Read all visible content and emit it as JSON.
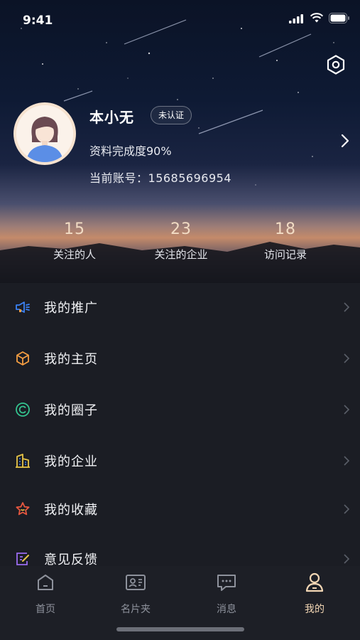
{
  "status_bar": {
    "time": "9:41"
  },
  "profile": {
    "name": "本小无",
    "verify_badge": "未认证",
    "completion": "资料完成度90%",
    "account_label": "当前账号：",
    "account_number": "15685696954"
  },
  "stats": [
    {
      "value": "15",
      "label": "关注的人"
    },
    {
      "value": "23",
      "label": "关注的企业"
    },
    {
      "value": "18",
      "label": "访问记录"
    }
  ],
  "menu": [
    {
      "label": "我的推广",
      "icon": "megaphone-icon",
      "color": "#3b82f6"
    },
    {
      "label": "我的主页",
      "icon": "cube-icon",
      "color": "#f59e42"
    },
    {
      "label": "我的圈子",
      "icon": "circle-c-icon",
      "color": "#34c38f"
    },
    {
      "label": "我的企业",
      "icon": "building-icon",
      "color": "#e8c547"
    },
    {
      "label": "我的收藏",
      "icon": "star-icon",
      "color": "#e8573f"
    },
    {
      "label": "意见反馈",
      "icon": "feedback-icon",
      "color": "#9b6cf0"
    }
  ],
  "tabs": [
    {
      "label": "首页",
      "icon": "home-icon"
    },
    {
      "label": "名片夹",
      "icon": "card-holder-icon"
    },
    {
      "label": "消息",
      "icon": "message-icon"
    },
    {
      "label": "我的",
      "icon": "person-icon",
      "active": true
    }
  ],
  "colors": {
    "accent": "#f2d6b4",
    "background": "#1b1d24",
    "stat_number": "#f2dcc4"
  }
}
